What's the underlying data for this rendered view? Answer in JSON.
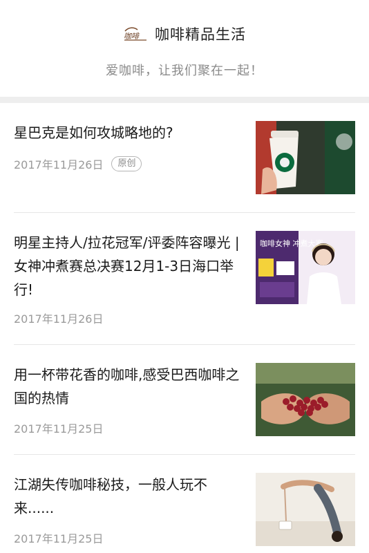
{
  "header": {
    "brand_name": "咖啡精品生活",
    "slogan": "爱咖啡，让我们聚在一起！"
  },
  "articles": [
    {
      "title": "星巴克是如何攻城略地的?",
      "date": "2017年11月26日",
      "badge": "原创",
      "thumb_icon": "starbucks-cup-image"
    },
    {
      "title": "明星主持人/拉花冠军/评委阵容曝光 | 女神冲煮赛总决赛12月1-3日海口举行!",
      "date": "2017年11月26日",
      "thumb_icon": "barista-contest-poster-image",
      "thumb_text": "咖啡女神 冲煮大赛"
    },
    {
      "title": "用一杯带花香的咖啡,感受巴西咖啡之国的热情",
      "date": "2017年11月25日",
      "thumb_icon": "coffee-cherries-in-hands-image"
    },
    {
      "title": "江湖失传咖啡秘技，一般人玩不来......",
      "date": "2017年11月25日",
      "thumb_icon": "barista-pour-stunt-image"
    }
  ]
}
